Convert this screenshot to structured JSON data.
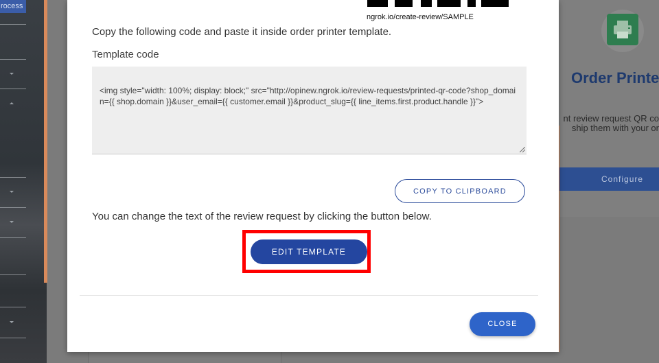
{
  "sidebar": {
    "badge": "rocess"
  },
  "background_card": {
    "title": "Order Printe",
    "desc_line1": "nt review request QR co",
    "desc_line2": "ship them with your or",
    "configure_label": "Configure",
    "icon": "printer-icon"
  },
  "modal": {
    "qr_url": "ngrok.io/create-review/SAMPLE",
    "instruction": "Copy the following code and paste it inside order printer template.",
    "template_label": "Template code",
    "template_code": "<img style=\"width: 100%; display: block;\" src=\"http://opinew.ngrok.io/review-requests/printed-qr-code?shop_domain={{ shop.domain }}&user_email={{ customer.email }}&product_slug={{ line_items.first.product.handle }}\">",
    "copy_label": "COPY TO CLIPBOARD",
    "change_text": "You can change the text of the review request by clicking the button below.",
    "edit_label": "EDIT TEMPLATE",
    "close_label": "CLOSE"
  },
  "colors": {
    "primary": "#2446a0",
    "close": "#2e64c9",
    "highlight": "#ff0000",
    "accent_orange": "#d98a5b"
  }
}
